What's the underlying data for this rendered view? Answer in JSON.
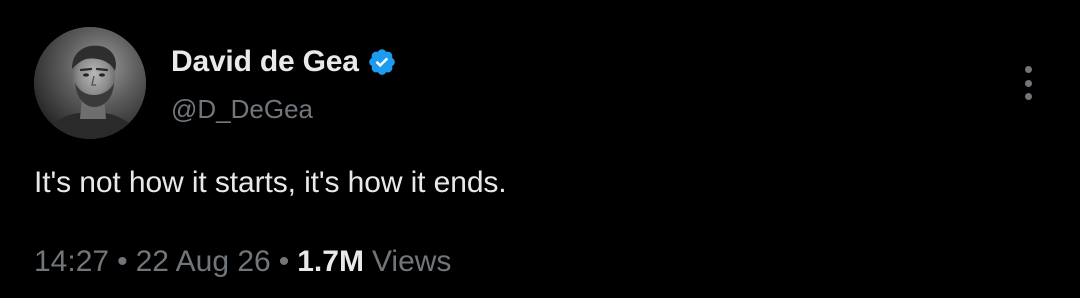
{
  "author": {
    "display_name": "David de Gea",
    "handle": "@D_DeGea",
    "verified": true,
    "verified_color": "#1d9bf0",
    "avatar_icon": "profile-photo"
  },
  "tweet": {
    "text": "It's not how it starts, it's how it ends."
  },
  "meta": {
    "time": "14:27",
    "separator": "•",
    "date": "22 Aug 26",
    "views_count": "1.7M",
    "views_label": "Views"
  },
  "actions": {
    "more_icon": "more-vertical-icon"
  },
  "colors": {
    "background": "#000000",
    "primary_text": "#e7e9ea",
    "secondary_text": "#71767b",
    "accent": "#1d9bf0"
  }
}
